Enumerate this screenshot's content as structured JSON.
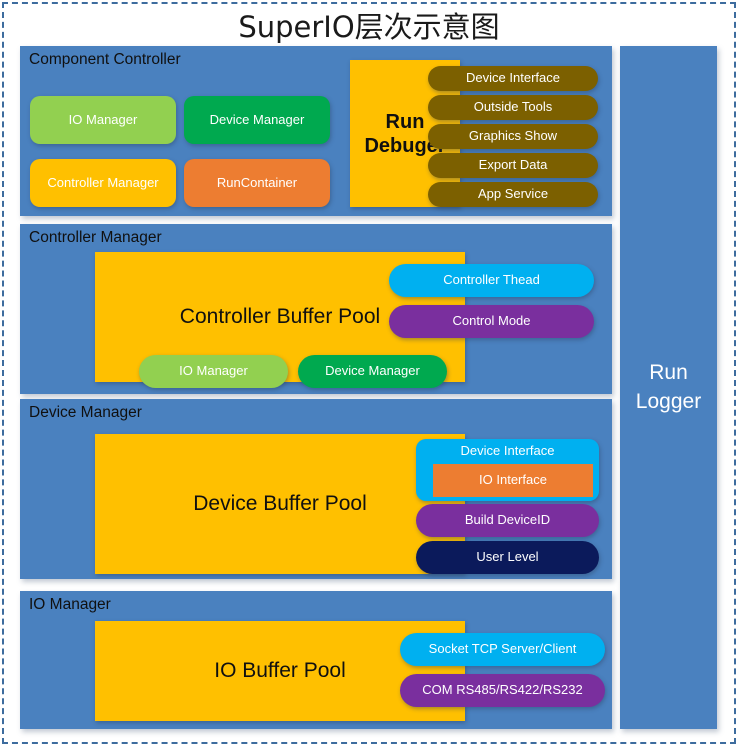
{
  "diagram": {
    "title": "SuperIO层次示意图",
    "colors": {
      "panel_blue": "#4A81BF",
      "green_light": "#92D050",
      "green": "#00A94F",
      "yellow": "#FFC000",
      "orange": "#ED7D31",
      "brown": "#7C6000",
      "cyan": "#00B0F0",
      "purple": "#7A2F9E",
      "navy": "#0B1A5B",
      "frame_dash": "#3D6C9E"
    },
    "panels": [
      {
        "label": "Component Controller",
        "blocks": [
          {
            "label": "IO Manager"
          },
          {
            "label": "Device Manager"
          },
          {
            "label": "Controller Manager"
          },
          {
            "label": "RunContainer"
          },
          {
            "label": "Run\nDebuger"
          },
          {
            "label": "Device Interface"
          },
          {
            "label": "Outside Tools"
          },
          {
            "label": "Graphics Show"
          },
          {
            "label": "Export Data"
          },
          {
            "label": "App Service"
          }
        ]
      },
      {
        "label": "Controller Manager",
        "blocks": [
          {
            "label": "Controller Buffer Pool"
          },
          {
            "label": "Controller Thead"
          },
          {
            "label": "Control Mode"
          },
          {
            "label": "IO Manager"
          },
          {
            "label": "Device Manager"
          }
        ]
      },
      {
        "label": "Device Manager",
        "blocks": [
          {
            "label": "Device Buffer Pool"
          },
          {
            "label": "Device Interface"
          },
          {
            "label": "IO Interface"
          },
          {
            "label": "Build DeviceID"
          },
          {
            "label": "User Level"
          }
        ]
      },
      {
        "label": "IO Manager",
        "blocks": [
          {
            "label": "IO Buffer Pool"
          },
          {
            "label": "Socket TCP Server/Client"
          },
          {
            "label": "COM RS485/RS422/RS232"
          }
        ]
      }
    ],
    "sidebar": {
      "label_line1": "Run",
      "label_line2": "Logger"
    }
  }
}
